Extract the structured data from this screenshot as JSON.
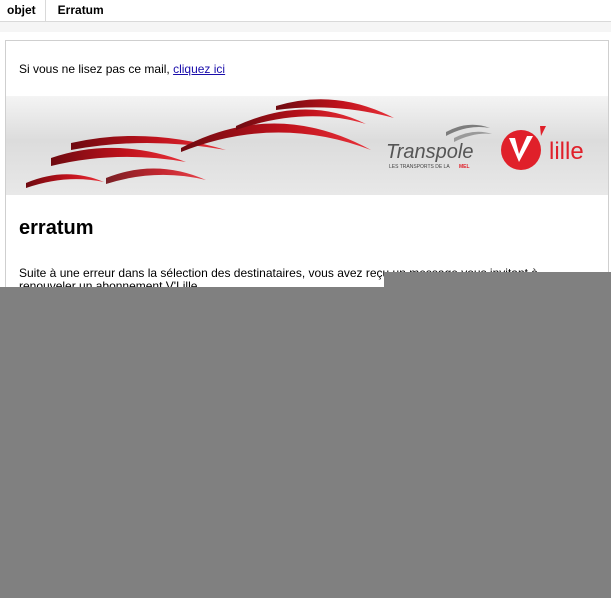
{
  "header": {
    "subject_label": "objet",
    "subject_value": "Erratum"
  },
  "email": {
    "preheader_text": "Si vous ne lisez pas ce mail, ",
    "preheader_link": "cliquez ici",
    "banner": {
      "transpole_name": "Transpole",
      "transpole_tagline": "LES TRANSPORTS DE LA",
      "tagline_highlight": "MEL",
      "vlille_logo": "V'lille",
      "colors": {
        "red": "#e0202a",
        "darkred": "#7a0a12",
        "grey": "#555555"
      }
    },
    "heading": "erratum",
    "body_text": "Suite à une erreur dans la sélection des destinataires, vous avez reçu un message vous invitant à renouveler un abonnement V'Lille."
  }
}
